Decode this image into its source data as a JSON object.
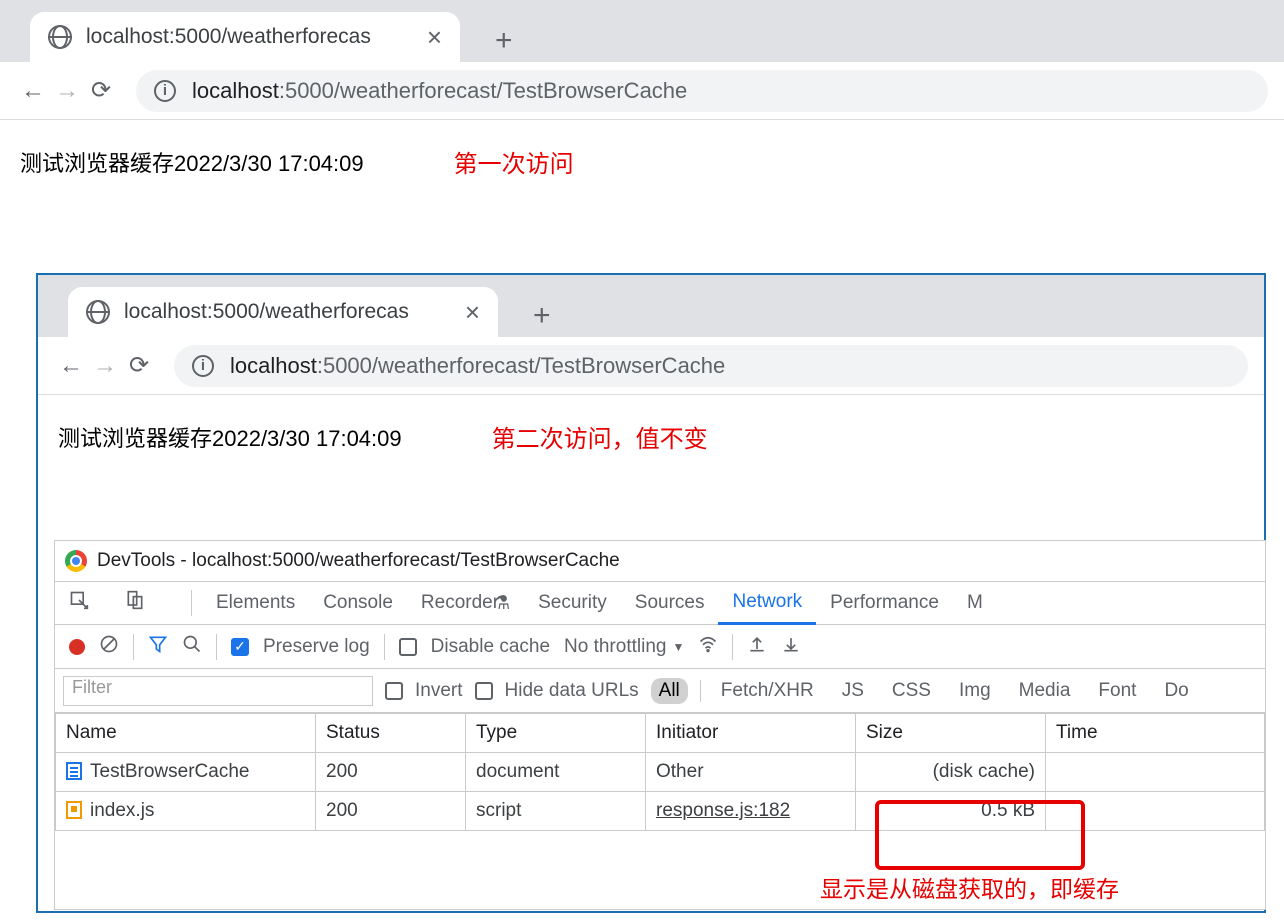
{
  "win1": {
    "tab_title": "localhost:5000/weatherforecas",
    "url_host": "localhost",
    "url_path": ":5000/weatherforecast/TestBrowserCache",
    "body_text": "测试浏览器缓存2022/3/30 17:04:09",
    "annotation": "第一次访问"
  },
  "win2": {
    "tab_title": "localhost:5000/weatherforecas",
    "url_host": "localhost",
    "url_path": ":5000/weatherforecast/TestBrowserCache",
    "body_text": "测试浏览器缓存2022/3/30 17:04:09",
    "annotation": "第二次访问，值不变"
  },
  "devtools": {
    "title": "DevTools - localhost:5000/weatherforecast/TestBrowserCache",
    "tabs": {
      "elements": "Elements",
      "console": "Console",
      "recorder": "Recorder",
      "security": "Security",
      "sources": "Sources",
      "network": "Network",
      "performance": "Performance",
      "more": "M"
    },
    "toolbar": {
      "preserve_log": "Preserve log",
      "disable_cache": "Disable cache",
      "throttle": "No throttling"
    },
    "filterbar": {
      "filter_placeholder": "Filter",
      "invert": "Invert",
      "hide_urls": "Hide data URLs",
      "types": {
        "all": "All",
        "xhr": "Fetch/XHR",
        "js": "JS",
        "css": "CSS",
        "img": "Img",
        "media": "Media",
        "font": "Font",
        "doc": "Do"
      }
    },
    "columns": {
      "name": "Name",
      "status": "Status",
      "type": "Type",
      "initiator": "Initiator",
      "size": "Size",
      "time": "Time"
    },
    "rows": [
      {
        "name": "TestBrowserCache",
        "status": "200",
        "type": "document",
        "initiator": "Other",
        "size": "(disk cache)",
        "time": ""
      },
      {
        "name": "index.js",
        "status": "200",
        "type": "script",
        "initiator": "response.js:182",
        "size": "0.5 kB",
        "time": ""
      }
    ],
    "annotation": "显示是从磁盘获取的，即缓存"
  }
}
